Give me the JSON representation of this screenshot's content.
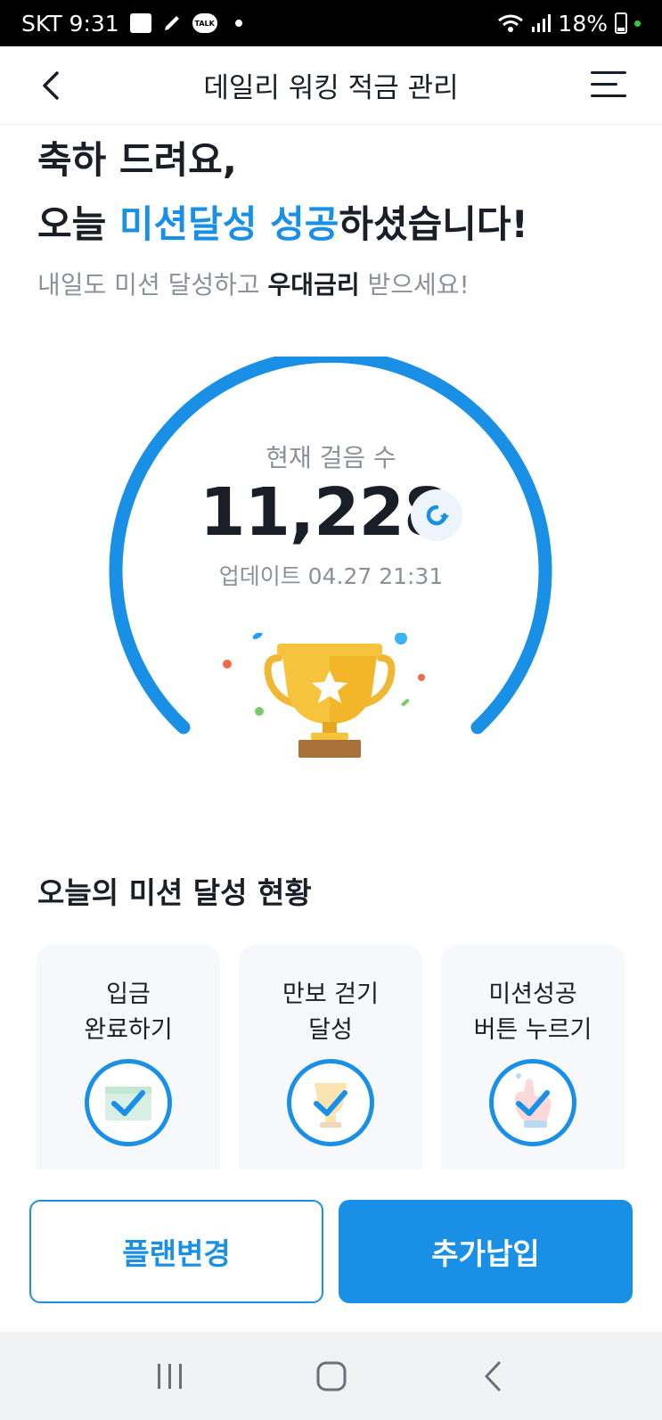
{
  "status_bar": {
    "carrier_time": "SKT 9:31",
    "talk_badge": "TALK",
    "battery": "18%",
    "icons": [
      "gallery-icon",
      "pen-icon",
      "talk-icon",
      "wifi-icon",
      "signal-icon",
      "battery-icon"
    ]
  },
  "header": {
    "title": "데일리 워킹 적금 관리",
    "back_icon": "chevron-left-icon",
    "menu_icon": "hamburger-menu-icon"
  },
  "hero": {
    "line1": "축하 드려요,",
    "line2_prefix": "오늘 ",
    "line2_highlight": "미션달성 성공",
    "line2_suffix": "하셨습니다!",
    "sub_prefix": "내일도 미션 달성하고 ",
    "sub_strong": "우대금리",
    "sub_suffix": " 받으세요!"
  },
  "steps": {
    "label": "현재 걸음 수",
    "value": "11,228",
    "update_label": "업데이트 04.27 21:31",
    "refresh_icon": "refresh-icon",
    "trophy_icon": "trophy-icon"
  },
  "missions": {
    "title": "오늘의 미션 달성 현황",
    "items": [
      {
        "line1": "입금",
        "line2": "완료하기",
        "icon": "check-deposit-icon",
        "done": true
      },
      {
        "line1": "만보 걷기",
        "line2": "달성",
        "icon": "check-trophy-icon",
        "done": true
      },
      {
        "line1": "미션성공",
        "line2": "버튼 누르기",
        "icon": "check-hand-icon",
        "done": true
      }
    ]
  },
  "buttons": {
    "plan_change": "플랜변경",
    "extra_payment": "추가납입"
  },
  "nav": {
    "recent_icon": "recent-apps-icon",
    "home_icon": "home-icon",
    "back_icon": "back-icon"
  },
  "colors": {
    "accent": "#1a8fe6",
    "text": "#1a1f27",
    "muted": "#8b9099",
    "card_bg": "#f6f8fb"
  }
}
